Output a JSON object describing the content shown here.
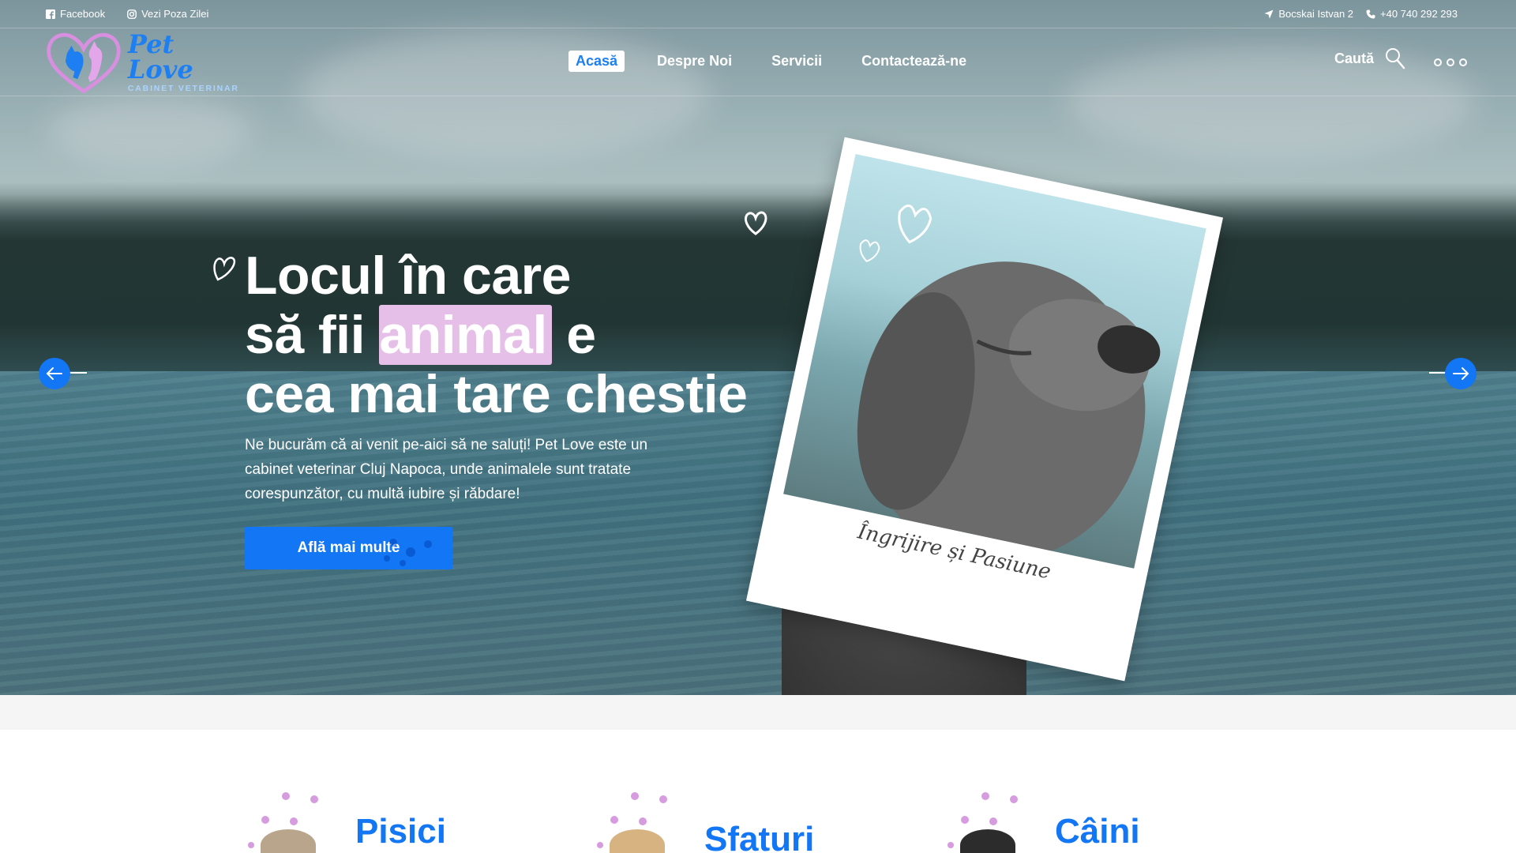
{
  "topbar": {
    "facebook_label": "Facebook",
    "instagram_label": "Vezi Poza Zilei",
    "address": "Bocskai Istvan 2",
    "phone": "+40 740 292 293"
  },
  "brand": {
    "name": "Pet Love",
    "tagline": "CABINET VETERINAR"
  },
  "nav": {
    "items": [
      {
        "label": "Acasă",
        "active": true
      },
      {
        "label": "Despre Noi",
        "active": false
      },
      {
        "label": "Servicii",
        "active": false
      },
      {
        "label": "Contactează-ne",
        "active": false
      }
    ]
  },
  "search": {
    "label": "Caută"
  },
  "hero": {
    "line1": "Locul în care",
    "line2_prefix": "să fii",
    "line2_highlight": "animal",
    "line2_suffix": "e",
    "line3": "cea mai tare chestie",
    "paragraph": "Ne bucurăm că ai venit pe-aici să ne saluți! Pet Love este un cabinet veterinar Cluj Napoca, unde animalele sunt tratate corespunzător, cu multă iubire și răbdare!",
    "cta_label": "Află mai multe",
    "polaroid_caption": "Îngrijire și Pasiune"
  },
  "categories": [
    {
      "title": "Pisici"
    },
    {
      "title": "Sfaturi"
    },
    {
      "title": "Câini"
    }
  ],
  "colors": {
    "accent": "#1276f5",
    "highlight": "#e6bfe8",
    "paw": "#d79be0"
  },
  "icons": {
    "facebook": "facebook-icon",
    "instagram": "instagram-icon",
    "location": "location-arrow-icon",
    "phone": "phone-icon",
    "search": "search-icon",
    "menu": "more-dots-icon",
    "prev": "arrow-left-icon",
    "next": "arrow-right-icon"
  }
}
